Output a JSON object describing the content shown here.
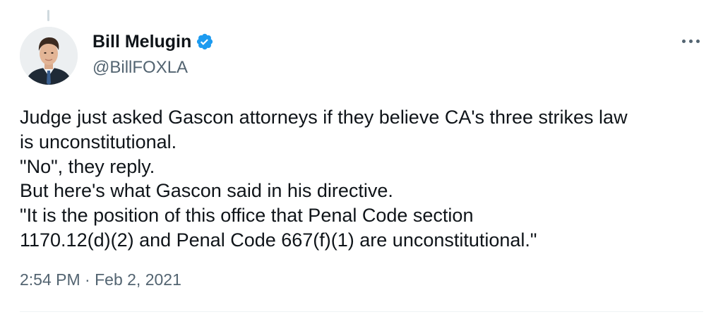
{
  "author": {
    "display_name": "Bill Melugin",
    "handle": "@BillFOXLA",
    "verified": true
  },
  "tweet": {
    "lines": [
      "Judge just asked Gascon attorneys if they believe CA's three strikes law",
      "is unconstitutional.",
      "\"No\", they reply.",
      "But here's what Gascon said in his directive.",
      "\"It is the position of this office that Penal Code section",
      "1170.12(d)(2) and Penal Code 667(f)(1) are unconstitutional.\""
    ],
    "time": "2:54 PM",
    "separator": " · ",
    "date": "Feb 2, 2021"
  },
  "icons": {
    "verified": "verified-badge-icon",
    "more": "more-options-icon"
  },
  "colors": {
    "primary_text": "#0f1419",
    "secondary_text": "#536471",
    "verified_blue": "#1d9bf0",
    "divider": "#eff3f4"
  }
}
